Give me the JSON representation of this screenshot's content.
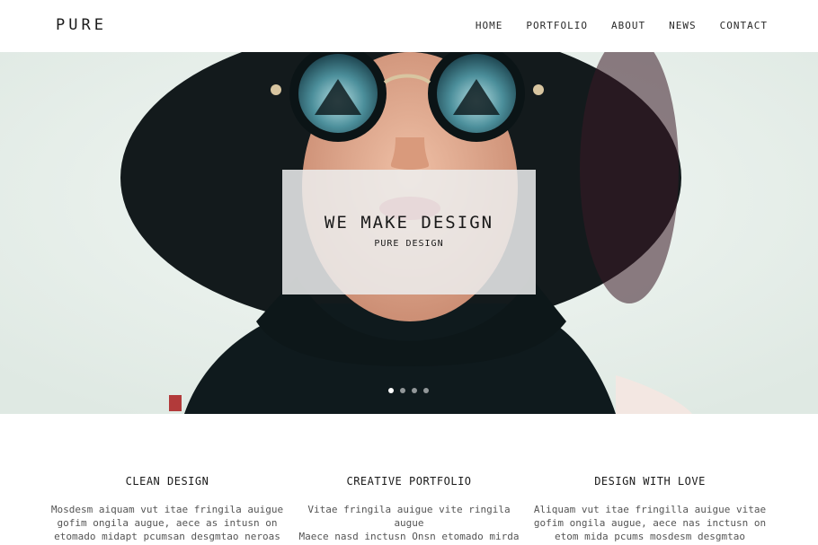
{
  "header": {
    "logo": "PURE",
    "nav": [
      "HOME",
      "PORTFOLIO",
      "ABOUT",
      "NEWS",
      "CONTACT"
    ]
  },
  "hero": {
    "title": "WE MAKE DESIGN",
    "subtitle": "PURE DESIGN",
    "slides_count": 4,
    "active_slide": 1
  },
  "features": [
    {
      "title": "CLEAN DESIGN",
      "line1": "Mosdesm aiquam vut itae fringila auigue",
      "line2": "gofim ongila augue, aece as intusn on",
      "line3": "etomado midapt pcumsan desgmtao neroas"
    },
    {
      "title": "CREATIVE PORTFOLIO",
      "line1": "Vitae fringila auigue vite ringila",
      "line2": "augue",
      "line3": "Maece nasd inctusn Onsn etomado mirda"
    },
    {
      "title": "DESIGN WITH LOVE",
      "line1": "Aliquam vut itae fringilla auigue vitae",
      "line2": "gofim ongila augue, aece nas inctusn on",
      "line3": "etom mida pcums mosdesm desgmtao"
    }
  ],
  "colors": {
    "hero_background": "#e9f1ec",
    "hat": "#141a1c",
    "text": "#1a1a1a"
  }
}
